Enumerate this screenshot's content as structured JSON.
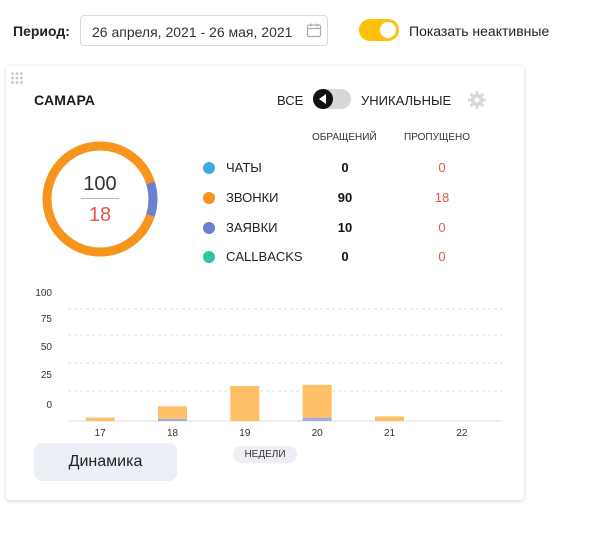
{
  "filters": {
    "period_label": "Период:",
    "period_value": "26 апреля, 2021 - 26 мая, 2021",
    "calendar_icon": "calendar-icon",
    "show_inactive_label": "Показать неактивные",
    "show_inactive": true
  },
  "card": {
    "title": "САМАРА",
    "mode_all": "ВСЕ",
    "mode_unique": "УНИКАЛЬНЫЕ",
    "mode_selected": "ВСЕ",
    "col_calls": "ОБРАЩЕНИЙ",
    "col_missed": "ПРОПУЩЕНО",
    "total": "100",
    "total_missed": "18",
    "channels": [
      {
        "name": "ЧАТЫ",
        "calls": "0",
        "missed": "0",
        "color": "#3fa9e0"
      },
      {
        "name": "ЗВОНКИ",
        "calls": "90",
        "missed": "18",
        "color": "#f7941d"
      },
      {
        "name": "ЗАЯВКИ",
        "calls": "10",
        "missed": "0",
        "color": "#6f7fcf"
      },
      {
        "name": "CALLBACKS",
        "calls": "0",
        "missed": "0",
        "color": "#2ec4a4"
      }
    ],
    "weeks_label": "НЕДЕЛИ",
    "dynamics_button": "Динамика"
  },
  "chart_data": {
    "type": "bar",
    "categories": [
      "17",
      "18",
      "19",
      "20",
      "21",
      "22"
    ],
    "series": [
      {
        "values": [
          0,
          2,
          0,
          3,
          0,
          0
        ],
        "color": "#a5acd8"
      },
      {
        "values": [
          3,
          11,
          31,
          29,
          4,
          0
        ],
        "color": "#ffbf66"
      }
    ],
    "stacked": true,
    "y_ticks": [
      "100",
      "75",
      "50",
      "25",
      "0"
    ],
    "ylim": [
      0,
      100
    ],
    "xlabel": "НЕДЕЛИ",
    "grid": true
  }
}
